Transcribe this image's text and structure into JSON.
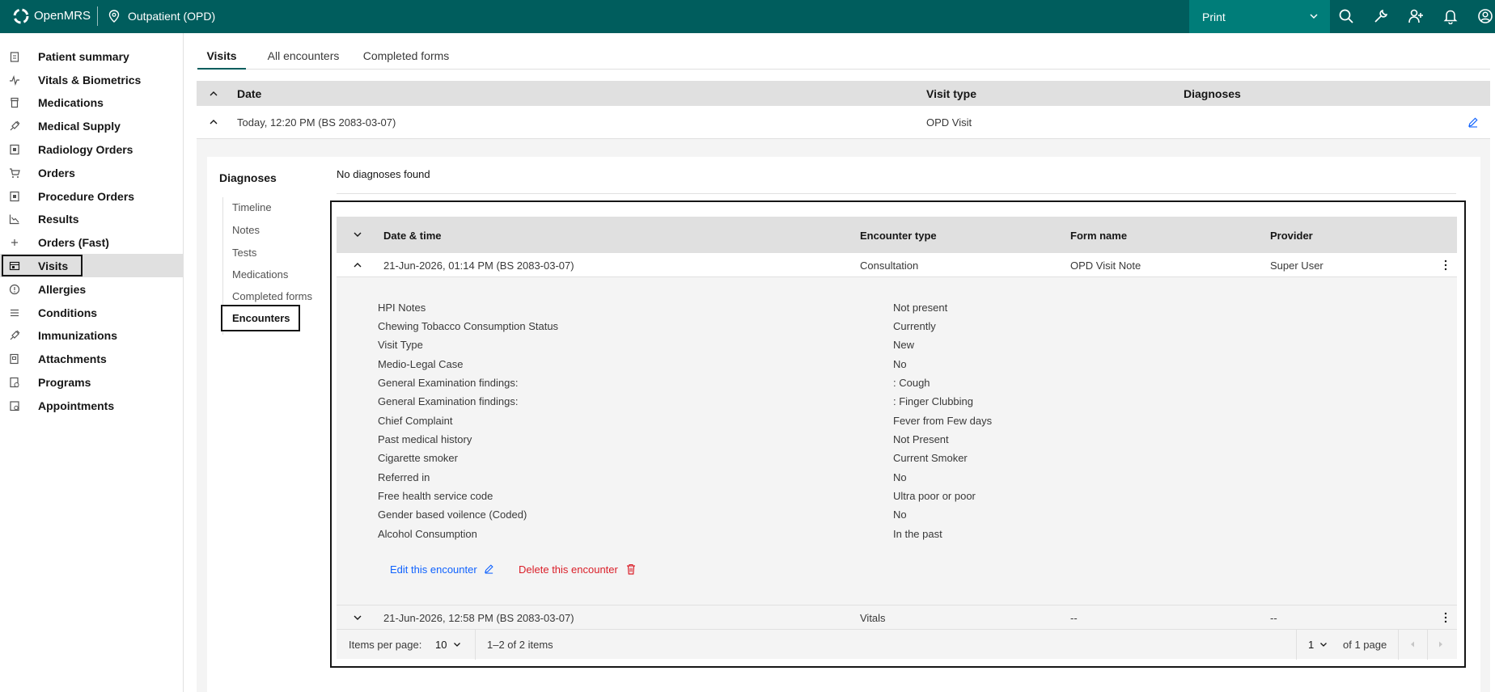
{
  "topbar": {
    "brand": "OpenMRS",
    "location": "Outpatient (OPD)",
    "print_label": "Print",
    "icons": [
      "search-icon",
      "wrench-icon",
      "add-patient-icon",
      "notification-icon",
      "user-avatar-icon"
    ]
  },
  "nav": {
    "items": [
      {
        "label": "Patient summary",
        "icon": "clipboard-icon"
      },
      {
        "label": "Vitals & Biometrics",
        "icon": "activity-icon"
      },
      {
        "label": "Medications",
        "icon": "pill-bottle-icon"
      },
      {
        "label": "Medical Supply",
        "icon": "syringe-icon"
      },
      {
        "label": "Radiology Orders",
        "icon": "xray-icon"
      },
      {
        "label": "Orders",
        "icon": "cart-icon"
      },
      {
        "label": "Procedure Orders",
        "icon": "procedure-icon"
      },
      {
        "label": "Results",
        "icon": "chart-icon"
      },
      {
        "label": "Orders (Fast)",
        "icon": "plus-icon"
      },
      {
        "label": "Visits",
        "icon": "visits-icon"
      },
      {
        "label": "Allergies",
        "icon": "warning-circle-icon"
      },
      {
        "label": "Conditions",
        "icon": "list-icon"
      },
      {
        "label": "Immunizations",
        "icon": "vaccine-icon"
      },
      {
        "label": "Attachments",
        "icon": "attachment-icon"
      },
      {
        "label": "Programs",
        "icon": "programs-icon"
      },
      {
        "label": "Appointments",
        "icon": "calendar-icon"
      }
    ],
    "active_index": 9
  },
  "tabs": [
    "Visits",
    "All encounters",
    "Completed forms"
  ],
  "visits_table": {
    "headers": {
      "date": "Date",
      "visit_type": "Visit type",
      "diagnoses": "Diagnoses"
    },
    "row": {
      "date": "Today, 12:20 PM (BS 2083-03-07)",
      "visit_type": "OPD Visit"
    }
  },
  "visit_detail": {
    "diagnoses_title": "Diagnoses",
    "no_diagnoses": "No diagnoses found",
    "side_links": [
      "Timeline",
      "Notes",
      "Tests",
      "Medications",
      "Completed forms",
      "Encounters"
    ]
  },
  "encounters": {
    "headers": {
      "datetime": "Date & time",
      "type": "Encounter type",
      "form": "Form name",
      "provider": "Provider"
    },
    "rows": [
      {
        "datetime": "21-Jun-2026, 01:14 PM (BS 2083-03-07)",
        "type": "Consultation",
        "form": "OPD Visit Note",
        "provider": "Super User"
      },
      {
        "datetime": "21-Jun-2026, 12:58 PM (BS 2083-03-07)",
        "type": "Vitals",
        "form": "--",
        "provider": "--"
      }
    ],
    "observations": [
      {
        "label": "HPI Notes",
        "value": "Not present"
      },
      {
        "label": "Chewing Tobacco Consumption Status",
        "value": "Currently"
      },
      {
        "label": "Visit Type",
        "value": "New"
      },
      {
        "label": "Medio-Legal Case",
        "value": "No"
      },
      {
        "label": "General Examination findings:",
        "value": ": Cough"
      },
      {
        "label": "General Examination findings:",
        "value": ": Finger Clubbing"
      },
      {
        "label": "Chief Complaint",
        "value": "Fever from Few days"
      },
      {
        "label": "Past medical history",
        "value": "Not Present"
      },
      {
        "label": "Cigarette smoker",
        "value": "Current Smoker"
      },
      {
        "label": "Referred in",
        "value": "No"
      },
      {
        "label": "Free health service code",
        "value": "Ultra poor or poor"
      },
      {
        "label": "Gender based voilence (Coded)",
        "value": "No"
      },
      {
        "label": "Alcohol Consumption",
        "value": "In the past"
      }
    ],
    "edit_label": "Edit this encounter",
    "delete_label": "Delete this encounter",
    "pager": {
      "items_per_page_label": "Items per page:",
      "items_per_page": "10",
      "range": "1–2 of 2 items",
      "page": "1",
      "of_pages": "of 1 page"
    }
  },
  "colors": {
    "topbar": "#005d5d",
    "print_button": "#007d79",
    "link": "#0f62fe",
    "danger": "#da1e28"
  }
}
